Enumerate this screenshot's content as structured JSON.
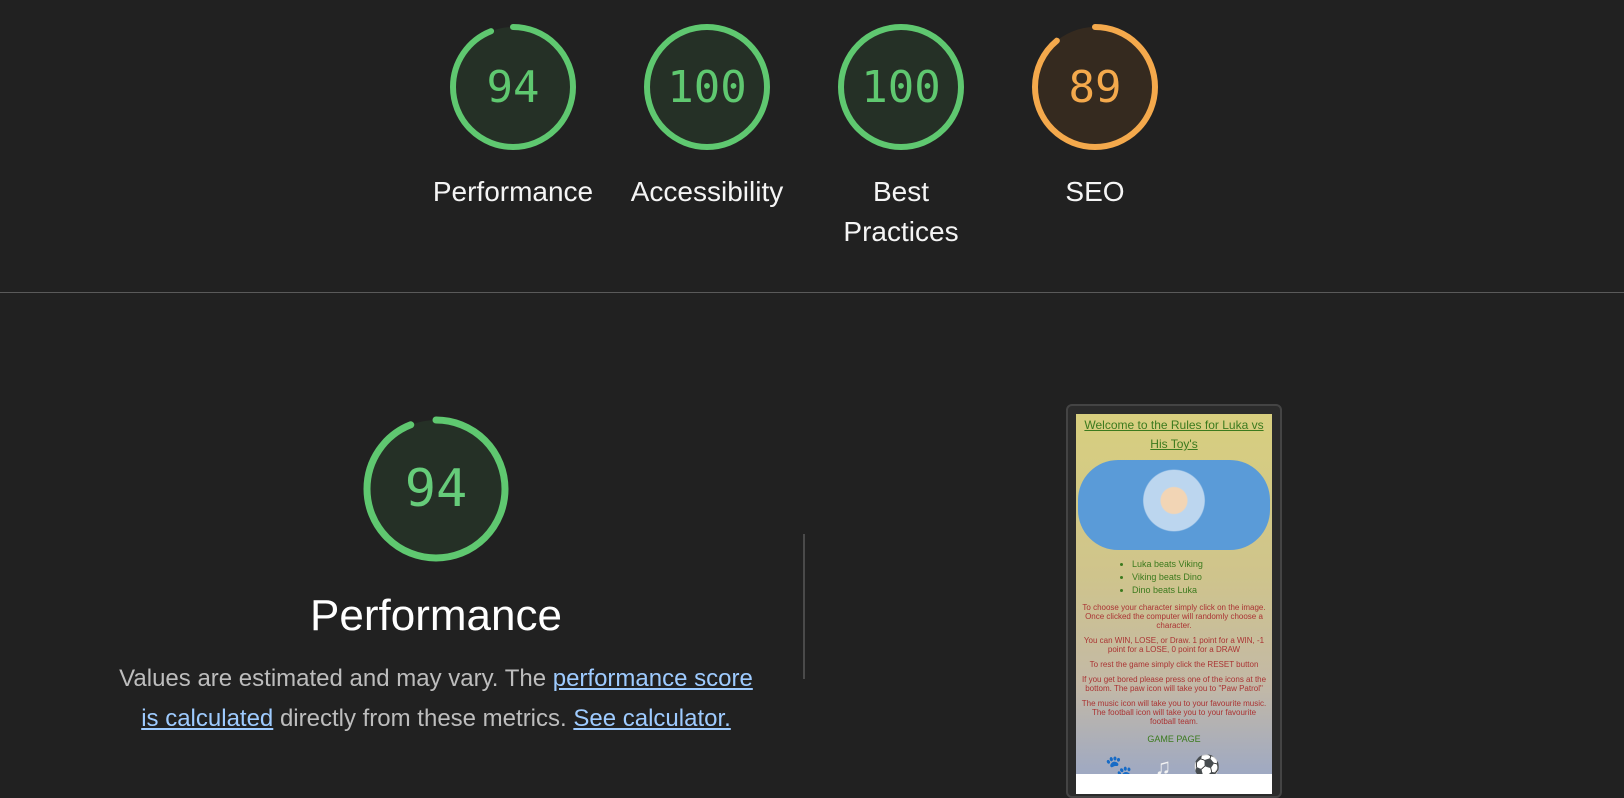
{
  "scores": [
    {
      "label": "Performance",
      "value": "94",
      "fraction": 0.94,
      "color": "#5fc870",
      "fill": "#253026"
    },
    {
      "label": "Accessibility",
      "value": "100",
      "fraction": 1.0,
      "color": "#5fc870",
      "fill": "#253026"
    },
    {
      "label": "Best Practices",
      "value": "100",
      "fraction": 1.0,
      "color": "#5fc870",
      "fill": "#253026"
    },
    {
      "label": "SEO",
      "value": "89",
      "fraction": 0.89,
      "color": "#f4a94c",
      "fill": "#352a1f"
    }
  ],
  "performance": {
    "score": "94",
    "fraction": 0.94,
    "title": "Performance",
    "desc_prefix": "Values are estimated and may vary. The ",
    "link1": "performance score is calculated",
    "desc_middle": " directly from these metrics. ",
    "link2": "See calculator."
  },
  "screenshot": {
    "heading": "Welcome to the Rules for Luka vs His Toy's",
    "rules": [
      "Luka beats Viking",
      "Viking beats Dino",
      "Dino beats Luka"
    ],
    "paragraphs": [
      "To choose your character simply click on the image. Once clicked the computer will randomly choose a character.",
      "You can WIN, LOSE, or Draw. 1 point for a WIN, -1 point for a LOSE, 0 point for a DRAW",
      "To rest the game simply click the RESET button",
      "If you get bored please press one of the icons at the bottom. The paw icon will take you to \"Paw Patrol\"",
      "The music icon will take you to your favourite music. The football icon will take you to your favourite football team."
    ],
    "game_link": "GAME PAGE",
    "icons": [
      "paw-icon",
      "music-icon",
      "football-icon"
    ]
  }
}
